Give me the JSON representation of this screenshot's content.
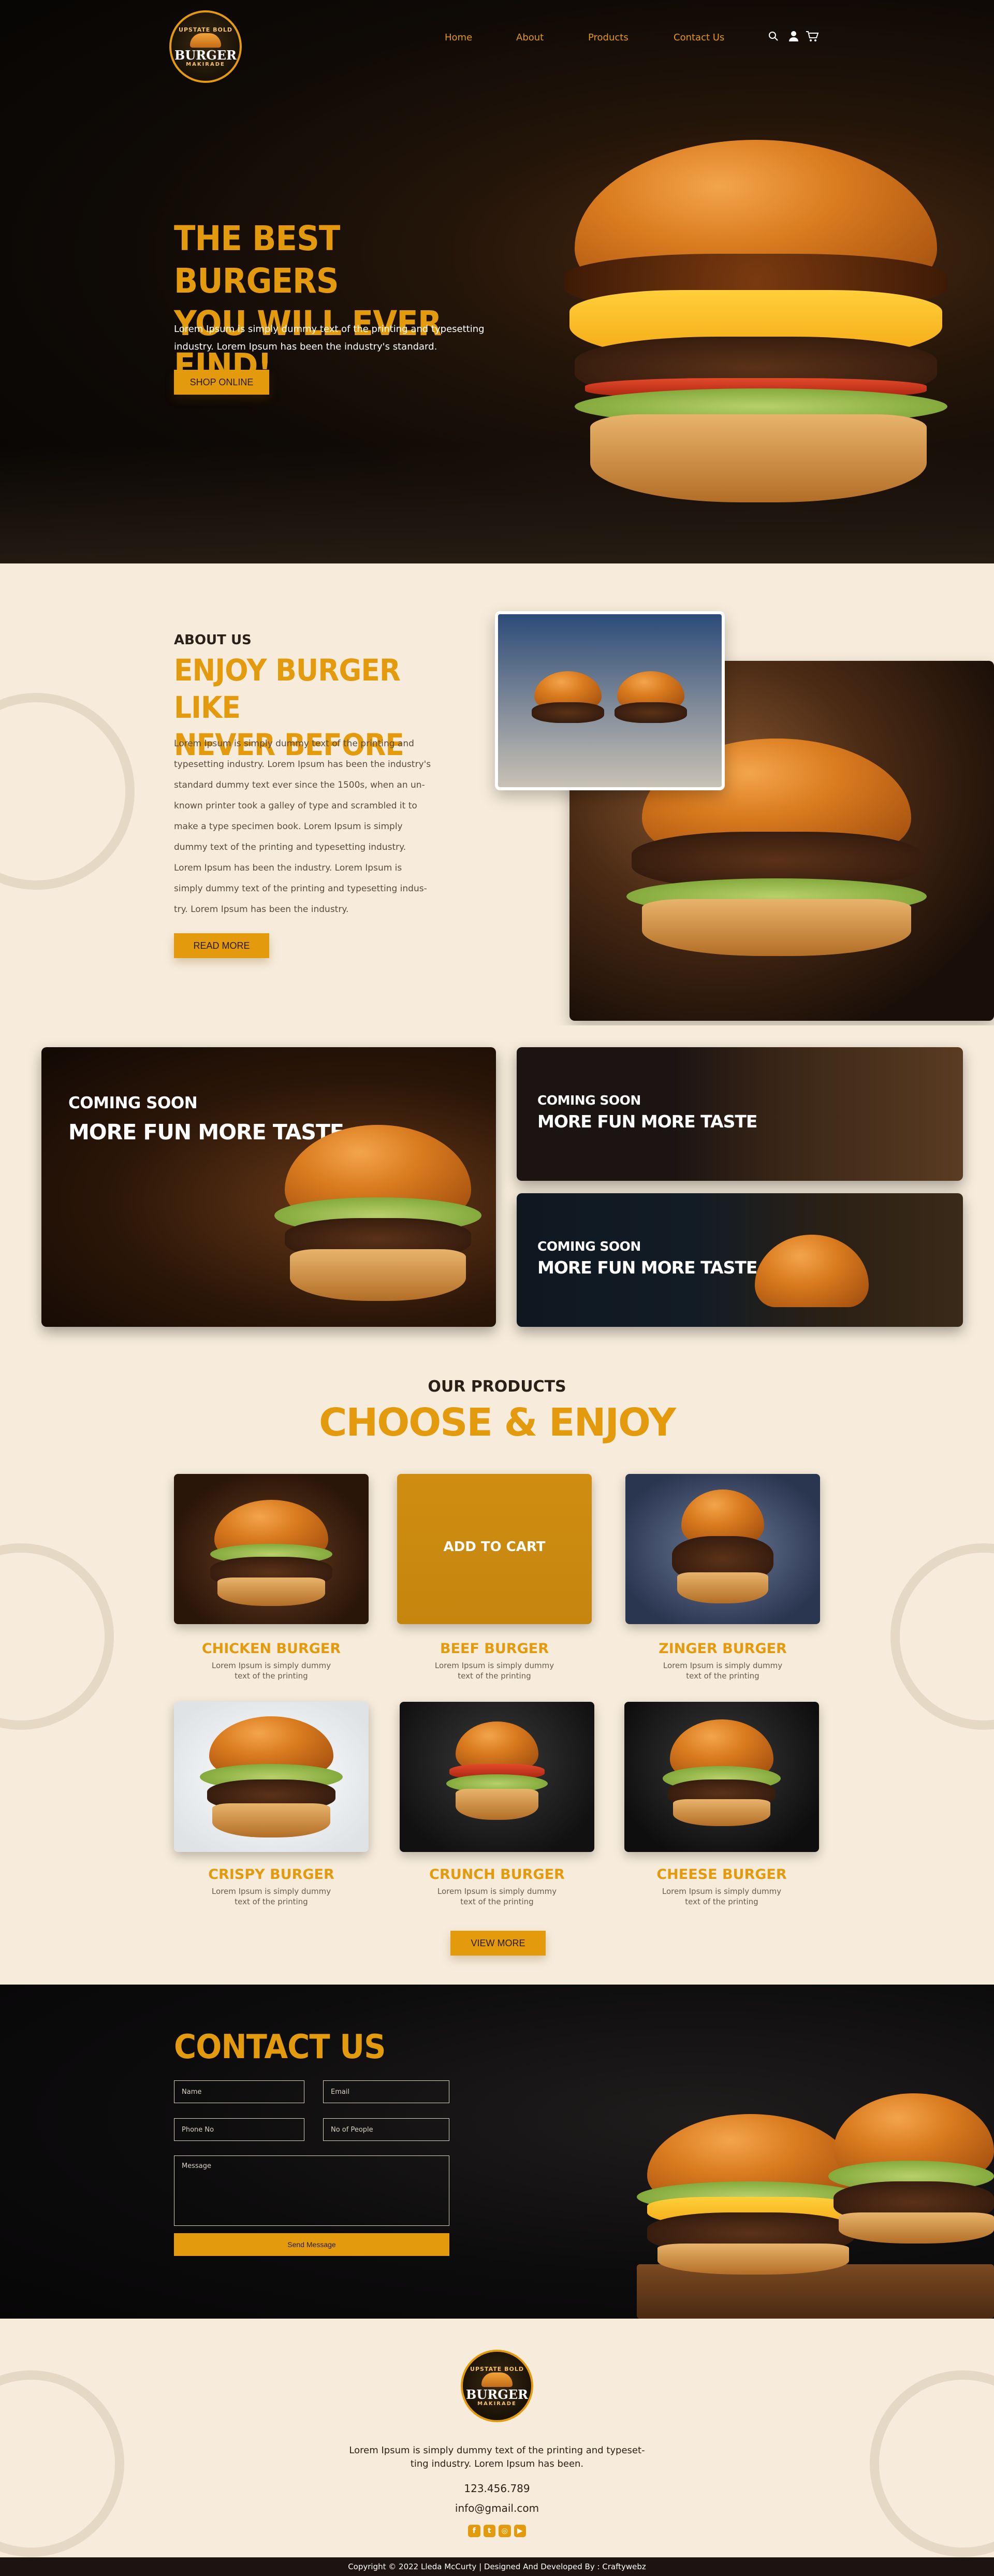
{
  "brand": {
    "logo_top": "UPSTATE BOLD",
    "logo_main": "BURGER",
    "logo_bottom": "MAKIRADE"
  },
  "nav": {
    "items": [
      "Home",
      "About",
      "Products",
      "Contact Us"
    ],
    "icons": [
      "search-icon",
      "user-icon",
      "cart-icon"
    ]
  },
  "hero": {
    "title_line1": "THE BEST BURGERS",
    "title_line2": "YOU WILL EVER FIND!",
    "text_line1": "Lorem Ipsum is simply dummy text of the printing and typesetting",
    "text_line2": "industry. Lorem Ipsum has been the industry's standard.",
    "button": "SHOP ONLINE"
  },
  "about": {
    "label": "ABOUT US",
    "title_line1": "ENJOY BURGER LIKE",
    "title_line2": "NEVER BEFORE",
    "paragraph": [
      "Lorem Ipsum is simply dummy text of the printing and",
      "typesetting industry. Lorem Ipsum has been the industry's",
      "standard dummy text ever since the 1500s, when an un-",
      "known printer took a galley of type and scrambled it to",
      "make a type specimen book. Lorem Ipsum is simply",
      "dummy text of the printing and typesetting industry.",
      "Lorem Ipsum has been the industry. Lorem Ipsum is",
      "simply dummy text of the printing and typesetting indus-",
      "try. Lorem Ipsum has been the industry."
    ],
    "button": "READ MORE"
  },
  "promos": [
    {
      "kicker": "COMING SOON",
      "headline": "MORE FUN MORE TASTE"
    },
    {
      "kicker": "COMING SOON",
      "headline": "MORE FUN MORE TASTE"
    },
    {
      "kicker": "COMING SOON",
      "headline": "MORE FUN MORE TASTE"
    }
  ],
  "products": {
    "label": "OUR PRODUCTS",
    "title": "CHOOSE & ENJOY",
    "overlay": "ADD TO CART",
    "items": [
      {
        "name": "CHICKEN BURGER",
        "desc1": "Lorem Ipsum is simply dummy",
        "desc2": "text of the printing"
      },
      {
        "name": "BEEF BURGER",
        "desc1": "Lorem Ipsum is simply dummy",
        "desc2": "text of the printing"
      },
      {
        "name": "ZINGER BURGER",
        "desc1": "Lorem Ipsum is simply dummy",
        "desc2": "text of the printing"
      },
      {
        "name": "CRISPY BURGER",
        "desc1": "Lorem Ipsum is simply dummy",
        "desc2": "text of the printing"
      },
      {
        "name": "CRUNCH BURGER",
        "desc1": "Lorem Ipsum is simply dummy",
        "desc2": "text of the printing"
      },
      {
        "name": "CHEESE BURGER",
        "desc1": "Lorem Ipsum is simply dummy",
        "desc2": "text of the printing"
      }
    ],
    "button": "VIEW MORE"
  },
  "contact": {
    "title": "CONTACT US",
    "name_placeholder": "Name",
    "email_placeholder": "Email",
    "phone_placeholder": "Phone No",
    "people_placeholder": "No of People",
    "message_placeholder": "Message",
    "button": "Send Message"
  },
  "footer": {
    "text_line1": "Lorem Ipsum is simply dummy text of the printing and typeset-",
    "text_line2": "ting industry. Lorem Ipsum has been.",
    "phone": "123.456.789",
    "email": "info@gmail.com",
    "social_icons": [
      "facebook-icon",
      "twitter-icon",
      "instagram-icon",
      "youtube-icon"
    ],
    "copyright": "Copyright © 2022 Lleda McCurty | Designed And Developed By : Craftywebz"
  },
  "colors": {
    "accent": "#e39b0d",
    "cream": "#f7ecdb",
    "dark": "#0f0a06"
  }
}
